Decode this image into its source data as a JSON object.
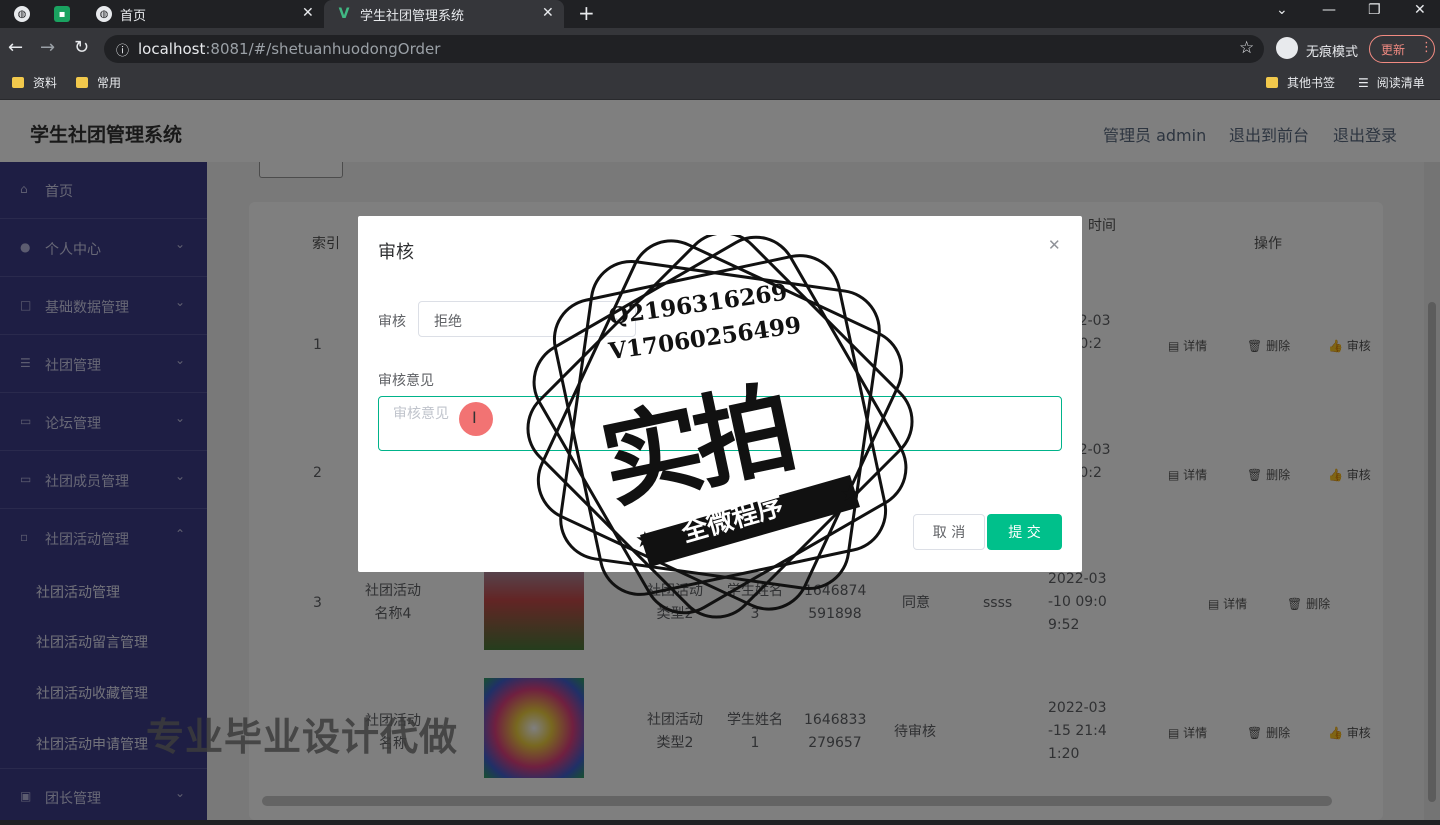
{
  "browser": {
    "tabs": [
      {
        "label": "首页"
      },
      {
        "label": "学生社团管理系统"
      }
    ],
    "url_host": "localhost",
    "url_rest": ":8081/#/shetuanhuodongOrder",
    "profile_label": "无痕模式",
    "update_label": "更新",
    "bookmarks": [
      "资料",
      "常用"
    ],
    "bookmarks_right": [
      "其他书签",
      "阅读清单"
    ]
  },
  "app": {
    "title": "学生社团管理系统",
    "header_links": [
      "管理员 admin",
      "退出到前台",
      "退出登录"
    ]
  },
  "sidebar": {
    "items": [
      {
        "label": "首页",
        "icon": "home-icon"
      },
      {
        "label": "个人中心",
        "icon": "user-icon"
      },
      {
        "label": "基础数据管理",
        "icon": "data-icon"
      },
      {
        "label": "社团管理",
        "icon": "list-icon"
      },
      {
        "label": "论坛管理",
        "icon": "forum-icon"
      },
      {
        "label": "社团成员管理",
        "icon": "members-icon"
      },
      {
        "label": "社团活动管理",
        "icon": "activity-icon"
      }
    ],
    "sub_items": [
      "社团活动管理",
      "社团活动留言管理",
      "社团活动收藏管理",
      "社团活动申请管理"
    ],
    "last_item": {
      "label": "团长管理",
      "icon": "leader-icon"
    }
  },
  "table": {
    "headers": {
      "index": "索引",
      "time_partial": "时间",
      "ops": "操作"
    },
    "rows": [
      {
        "index": "1",
        "time": "2022-03\n-10 0:2\n6",
        "actions": [
          "详情",
          "删除",
          "审核"
        ]
      },
      {
        "index": "2",
        "time": "2022-03\n-10 0:2\n9",
        "actions": [
          "详情",
          "删除",
          "审核"
        ]
      },
      {
        "index": "3",
        "name": "社团活动\n名称4",
        "type": "社团活动\n类型2",
        "student": "学生姓名\n3",
        "phone": "1646874\n591898",
        "status": "同意",
        "opinion": "ssss",
        "time": "2022-03\n-10 09:0\n9:52",
        "actions": [
          "详情",
          "删除"
        ]
      },
      {
        "index": "4",
        "name": "社团活动\n名称",
        "type": "社团活动\n类型2",
        "student": "学生姓名\n1",
        "phone": "1646833\n279657",
        "status": "待审核",
        "opinion": "",
        "time": "2022-03\n-15 21:4\n1:20",
        "actions": [
          "详情",
          "删除",
          "审核"
        ]
      }
    ]
  },
  "dialog": {
    "title": "审核",
    "audit_label": "审核",
    "audit_value": "拒绝",
    "opinion_label": "审核意见",
    "opinion_placeholder": "审核意见",
    "cancel_label": "取 消",
    "submit_label": "提 交"
  },
  "watermark": {
    "contact_q": "Q2196316269",
    "contact_v": "V17060256499",
    "big": "实拍",
    "banner": "全微程序",
    "bottom": "专业毕业设计代做"
  },
  "colors": {
    "sidebar": "#3c3c88",
    "accent": "#00c08b",
    "header_link": "#5a6a80"
  }
}
